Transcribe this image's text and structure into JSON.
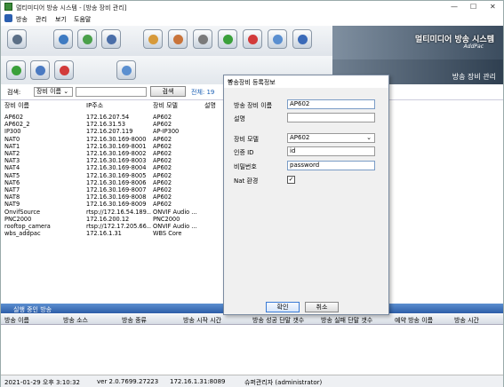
{
  "window": {
    "title": "멀티미디어 방송 시스템 - [방송 장비 관리]",
    "min": "—",
    "max": "☐",
    "close": "✕"
  },
  "menu": [
    "방송",
    "관리",
    "보기",
    "도움말"
  ],
  "banner": {
    "title": "멀티미디어 방송 시스템",
    "brand": "AddPac",
    "subtitle": "방송 장비 관리"
  },
  "search": {
    "label": "검색:",
    "field": "장비 이름",
    "button": "검색",
    "total": "전체: 19"
  },
  "grid": {
    "headers": [
      "장비 이름",
      "IP주소",
      "장비 모델",
      "설명"
    ],
    "rows": [
      [
        "AP602",
        "172.16.207.54",
        "AP602"
      ],
      [
        "AP602_2",
        "172.16.31.53",
        "AP602"
      ],
      [
        "IP300",
        "172.16.207.119",
        "AP-IP300"
      ],
      [
        "NAT0",
        "172.16.30.169-8000",
        "AP602"
      ],
      [
        "NAT1",
        "172.16.30.169-8001",
        "AP602"
      ],
      [
        "NAT2",
        "172.16.30.169-8002",
        "AP602"
      ],
      [
        "NAT3",
        "172.16.30.169-8003",
        "AP602"
      ],
      [
        "NAT4",
        "172.16.30.169-8004",
        "AP602"
      ],
      [
        "NAT5",
        "172.16.30.169-8005",
        "AP602"
      ],
      [
        "NAT6",
        "172.16.30.169-8006",
        "AP602"
      ],
      [
        "NAT7",
        "172.16.30.169-8007",
        "AP602"
      ],
      [
        "NAT8",
        "172.16.30.169-8008",
        "AP602"
      ],
      [
        "NAT9",
        "172.16.30.169-8009",
        "AP602"
      ],
      [
        "OnvifSource",
        "rtsp://172.16.54.189...",
        "ONVIF Audio ..."
      ],
      [
        "PNC2000",
        "172.16.200.12",
        "PNC2000"
      ],
      [
        "rooftop_camera",
        "rtsp://172.17.205.66...",
        "ONVIF Audio ..."
      ],
      [
        "wbs_addpac",
        "172.16.1.31",
        "WBS Core"
      ]
    ]
  },
  "dialog": {
    "title": "방송장비 등록정보",
    "name_label": "방송 장비 이름",
    "name_value": "AP602",
    "desc_label": "설명",
    "desc_value": "",
    "model_label": "장비 모델",
    "model_value": "AP602",
    "id_label": "인증 ID",
    "id_value": "id",
    "pw_label": "비밀번호",
    "pw_value": "password",
    "nat_label": "Nat 환경",
    "nat_checked": "✓",
    "ok": "확인",
    "cancel": "취소"
  },
  "bottom": {
    "title": "실행 중인 방송",
    "headers": [
      "방송 이름",
      "방송 소스",
      "방송 종류",
      "방송 시작 시간",
      "방송 성공 단말 갯수",
      "방송 실패 단말 갯수",
      "예약 방송 이름",
      "방송 시간"
    ]
  },
  "status": {
    "datetime": "2021-01-29 오후 3:10:32",
    "version": "ver 2.0.7699.27223",
    "server": "172.16.1.31:8089",
    "user": "슈퍼관리자 (administrator)"
  }
}
